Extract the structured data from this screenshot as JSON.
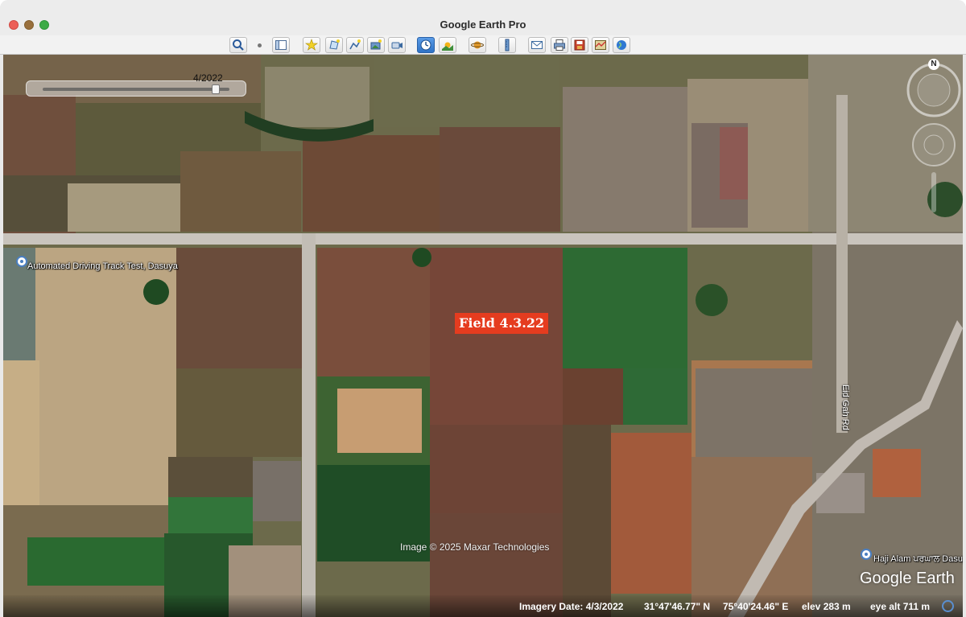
{
  "window": {
    "title": "Google Earth Pro"
  },
  "toolbar": {
    "buttons": [
      {
        "name": "search-icon"
      },
      {
        "name": "sidebar-toggle-icon"
      },
      {
        "name": "placemark-icon"
      },
      {
        "name": "polygon-icon"
      },
      {
        "name": "path-icon"
      },
      {
        "name": "overlay-icon"
      },
      {
        "name": "tour-icon"
      },
      {
        "name": "historical-imagery-icon"
      },
      {
        "name": "sunlight-icon"
      },
      {
        "name": "planets-icon"
      },
      {
        "name": "ruler-icon"
      },
      {
        "name": "email-icon"
      },
      {
        "name": "print-icon"
      },
      {
        "name": "save-image-icon"
      },
      {
        "name": "map-maker-icon"
      },
      {
        "name": "earth-gallery-icon"
      }
    ]
  },
  "timeslider": {
    "date": "4/2022"
  },
  "map": {
    "places": [
      {
        "label": "Automated Driving Track Test, Dasuya"
      },
      {
        "label": "Haji Alam ਪਰਘਾਲ Dasuya"
      }
    ],
    "road": "Eid Gah Rd",
    "field_label": "Field 4.3.22",
    "copyright": "Image © 2025 Maxar Technologies",
    "logo": "Google Earth",
    "compass_letter": "N"
  },
  "status": {
    "imagery_date": "Imagery Date: 4/3/2022",
    "lat": "31°47'46.77\" N",
    "lon": "75°40'24.46\" E",
    "elev": "elev  283 m",
    "eye_alt": "eye alt  711 m"
  },
  "colors": {
    "field_label_bg": "#e53c1f",
    "accent": "#2f73c6"
  }
}
